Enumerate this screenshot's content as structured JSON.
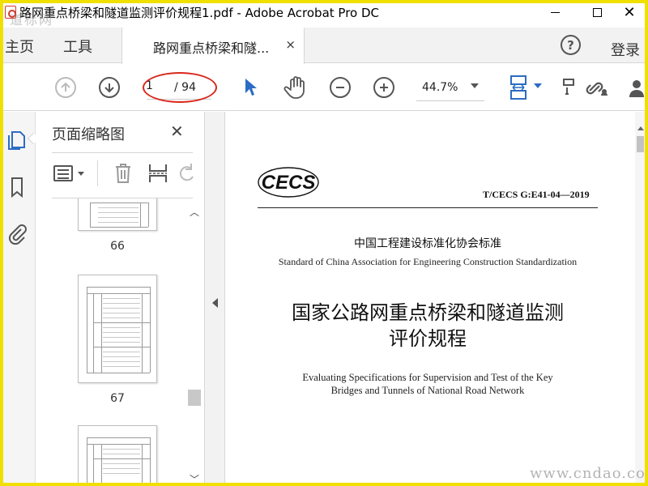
{
  "window": {
    "title": "路网重点桥梁和隧道监测评价规程1.pdf - Adobe Acrobat Pro DC",
    "close_glyph": "✕"
  },
  "watermarks": {
    "top_left": "道标网",
    "bottom_right": "www.cndao.com"
  },
  "menu": {
    "home": "主页",
    "tools": "工具",
    "login": "登录",
    "help_glyph": "?"
  },
  "tab": {
    "label": "路网重点桥梁和隧...",
    "close_glyph": "×"
  },
  "toolbar": {
    "current_page": "1",
    "total_pages": "/ 94",
    "zoom": "44.7%",
    "highlight_color": "#d9271c"
  },
  "thumbnails_panel": {
    "title": "页面缩略图",
    "close_glyph": "✕",
    "pages": [
      {
        "label": "66"
      },
      {
        "label": "67"
      },
      {
        "label": ""
      }
    ]
  },
  "document": {
    "logo_text": "CECS",
    "standard_code": "T/CECS G:E41-04—2019",
    "association_cn": "中国工程建设标准化协会标准",
    "association_en": "Standard of China Association for Engineering Construction Standardization",
    "title_cn_line1": "国家公路网重点桥梁和隧道监测",
    "title_cn_line2": "评价规程",
    "title_en_line1": "Evaluating Specifications for Supervision and Test of the Key",
    "title_en_line2": "Bridges and Tunnels of National Road Network"
  },
  "colors": {
    "accent_blue": "#2b6cc4",
    "frame_yellow": "#f0e000"
  }
}
